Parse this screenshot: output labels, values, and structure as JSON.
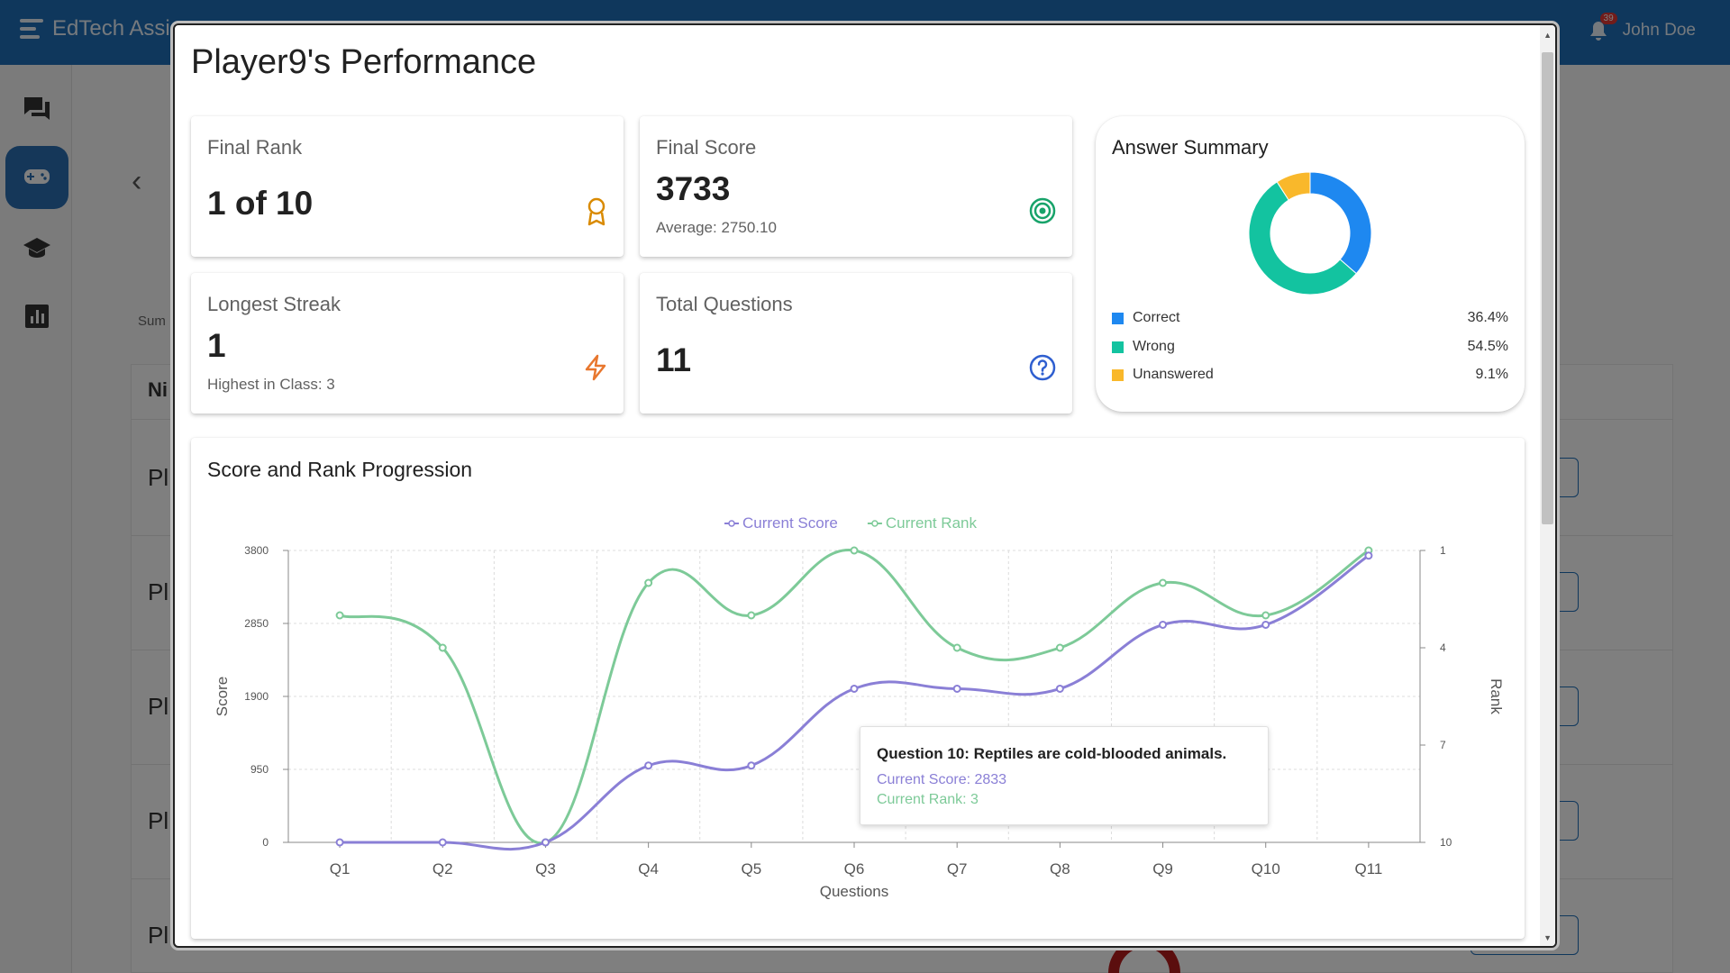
{
  "app": {
    "title": "EdTech Assis",
    "user_name": "John Doe",
    "notification_count": "39"
  },
  "background": {
    "summary_label": "Sum",
    "column_header": "Ni",
    "row_label": "Pl"
  },
  "modal": {
    "title": "Player9's Performance",
    "cards": {
      "final_rank": {
        "label": "Final Rank",
        "value": "1 of 10",
        "icon": "award-icon"
      },
      "final_score": {
        "label": "Final Score",
        "value": "3733",
        "sub": "Average: 2750.10",
        "icon": "target-icon"
      },
      "longest_streak": {
        "label": "Longest Streak",
        "value": "1",
        "sub": "Highest in Class: 3",
        "icon": "lightning-icon"
      },
      "total_questions": {
        "label": "Total Questions",
        "value": "11",
        "icon": "question-circle-icon"
      }
    },
    "answer_summary": {
      "title": "Answer Summary",
      "items": [
        {
          "label": "Correct",
          "pct": "36.4%",
          "value": 36.4,
          "color": "#1e88f0"
        },
        {
          "label": "Wrong",
          "pct": "54.5%",
          "value": 54.5,
          "color": "#13c3a0"
        },
        {
          "label": "Unanswered",
          "pct": "9.1%",
          "value": 9.1,
          "color": "#f9b82b"
        }
      ]
    },
    "progression": {
      "title": "Score and Rank Progression"
    },
    "tooltip": {
      "title": "Question 10: Reptiles are cold-blooded animals.",
      "score_line": "Current Score: 2833",
      "rank_line": "Current Rank: 3"
    }
  },
  "chart_data": {
    "type": "line",
    "categories": [
      "Q1",
      "Q2",
      "Q3",
      "Q4",
      "Q5",
      "Q6",
      "Q7",
      "Q8",
      "Q9",
      "Q10",
      "Q11"
    ],
    "series": [
      {
        "name": "Current Score",
        "axis": "left",
        "color": "#8a7fd6",
        "values": [
          0,
          0,
          0,
          1000,
          1000,
          2000,
          2000,
          2000,
          2833,
          2833,
          3733
        ]
      },
      {
        "name": "Current Rank",
        "axis": "right",
        "color": "#7dca98",
        "values": [
          3,
          4,
          10,
          2,
          3,
          1,
          4,
          4,
          2,
          3,
          1
        ]
      }
    ],
    "xlabel": "Questions",
    "ylabel": "Score",
    "y2label": "Rank",
    "ylim": [
      0,
      3800
    ],
    "yticks": [
      "3800",
      "2850",
      "1900",
      "950",
      "0"
    ],
    "y2lim": [
      1,
      10
    ],
    "y2ticks": [
      "1",
      "4",
      "7",
      "10"
    ],
    "y2_reversed": true,
    "legend": "top-center",
    "grid": true
  }
}
